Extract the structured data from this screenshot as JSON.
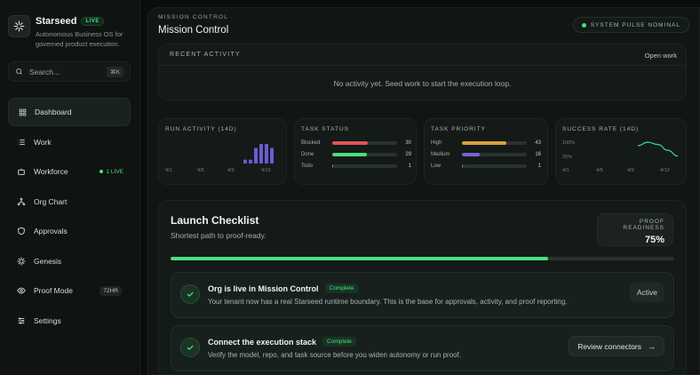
{
  "brand": {
    "name": "Starseed",
    "badge": "LIVE",
    "tagline": "Autonomous Business OS for governed product execution."
  },
  "search": {
    "placeholder": "Search...",
    "shortcut": "⌘K"
  },
  "nav": [
    {
      "label": "Dashboard",
      "icon": "grid-icon",
      "active": true
    },
    {
      "label": "Work",
      "icon": "list-icon"
    },
    {
      "label": "Workforce",
      "icon": "bot-icon",
      "badge": "1 LIVE"
    },
    {
      "label": "Org Chart",
      "icon": "network-icon"
    },
    {
      "label": "Approvals",
      "icon": "shield-icon"
    },
    {
      "label": "Genesis",
      "icon": "sparkle-icon"
    },
    {
      "label": "Proof Mode",
      "icon": "eye-icon",
      "pill": "72HR"
    },
    {
      "label": "Settings",
      "icon": "sliders-icon"
    }
  ],
  "header": {
    "eyebrow": "MISSION CONTROL",
    "title": "Mission Control",
    "pulse": "SYSTEM PULSE NOMINAL"
  },
  "recent": {
    "title": "RECENT ACTIVITY",
    "link": "Open work",
    "empty": "No activity yet. Seed work to start the execution loop."
  },
  "chart_data": [
    {
      "type": "bar",
      "title": "RUN ACTIVITY (14D)",
      "x_ticks": [
        "4/1",
        "4/5",
        "4/9",
        "4/13"
      ],
      "x": [
        "4/7",
        "4/8",
        "4/9",
        "4/10",
        "4/11",
        "4/12"
      ],
      "values": [
        1,
        1,
        4,
        5,
        5,
        4
      ],
      "color": "#6d5bd0"
    },
    {
      "type": "bar",
      "title": "TASK STATUS",
      "categories": [
        "Blocked",
        "Done",
        "Todo"
      ],
      "values": [
        30,
        29,
        1
      ],
      "fill": [
        0.55,
        0.54,
        0.02
      ],
      "colors": [
        "#e05555",
        "#4ade80",
        "#8b9490"
      ]
    },
    {
      "type": "bar",
      "title": "TASK PRIORITY",
      "categories": [
        "High",
        "Medium",
        "Low"
      ],
      "values": [
        43,
        16,
        1
      ],
      "fill": [
        0.69,
        0.27,
        0.02
      ],
      "colors": [
        "#d8a13c",
        "#7a62d8",
        "#8b9490"
      ]
    },
    {
      "type": "line",
      "title": "SUCCESS RATE (14D)",
      "y_ticks": [
        "100%",
        "25%"
      ],
      "x_ticks": [
        "4/1",
        "4/5",
        "4/9",
        "4/13"
      ],
      "x": [
        "4/9",
        "4/10",
        "4/11",
        "4/12",
        "4/13"
      ],
      "values": [
        85,
        100,
        90,
        65,
        40
      ],
      "ylim": [
        0,
        100
      ],
      "color": "#3ed598"
    }
  ],
  "checklist": {
    "title": "Launch Checklist",
    "subtitle": "Shortest path to proof-ready.",
    "readiness_label": "PROOF READINESS",
    "readiness_value": "75%",
    "progress": 0.75,
    "tasks": [
      {
        "title": "Org is live in Mission Control",
        "badge": "Complete",
        "desc": "Your tenant now has a real Starseed runtime boundary. This is the base for approvals, activity, and proof reporting.",
        "status": "Active"
      },
      {
        "title": "Connect the execution stack",
        "badge": "Complete",
        "desc": "Verify the model, repo, and task source before you widen autonomy or run proof.",
        "button": "Review connectors"
      }
    ]
  }
}
